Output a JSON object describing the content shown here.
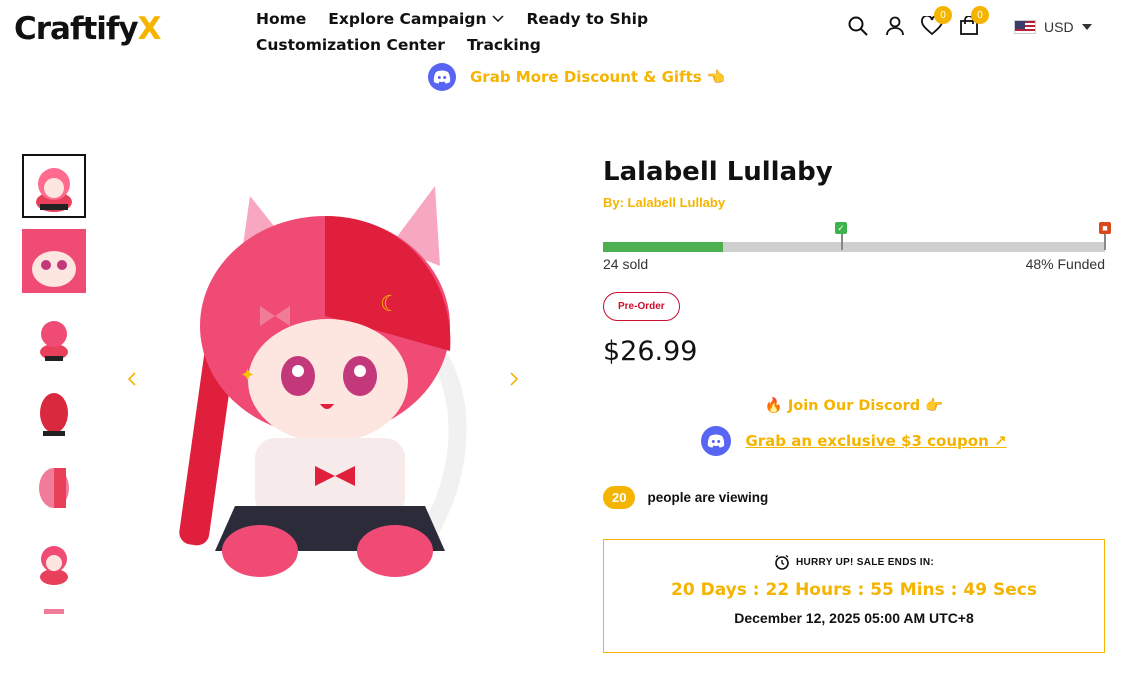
{
  "header": {
    "logo_text": "Craftify",
    "logo_accent": "X",
    "nav": [
      {
        "label": "Home"
      },
      {
        "label": "Explore Campaign"
      },
      {
        "label": "Ready to Ship"
      },
      {
        "label": "Customization Center"
      },
      {
        "label": "Tracking"
      }
    ],
    "wishlist_count": "0",
    "cart_count": "0",
    "currency": "USD"
  },
  "promo": {
    "text": "Grab More Discount & Gifts 👈"
  },
  "product": {
    "title": "Lalabell Lullaby",
    "by": "By: Lalabell Lullaby",
    "sold": "24 sold",
    "funded": "48% Funded",
    "funded_fraction": 0.24,
    "badge": "Pre-Order",
    "price": "$26.99",
    "discord_join": "🔥 Join Our Discord 👉",
    "discord_coupon": "Grab an exclusive $3 coupon ↗",
    "viewing_count": "20",
    "viewing_text": "people are viewing",
    "sale_header": "HURRY UP! SALE ENDS IN:",
    "countdown": "20 Days : 22 Hours : 55 Mins : 49 Secs",
    "sale_date": "December 12, 2025 05:00 AM UTC+8"
  },
  "colors": {
    "accent": "#f5b400",
    "progress": "#4caf50",
    "preorder": "#c8102e",
    "discord": "#5865f2"
  }
}
